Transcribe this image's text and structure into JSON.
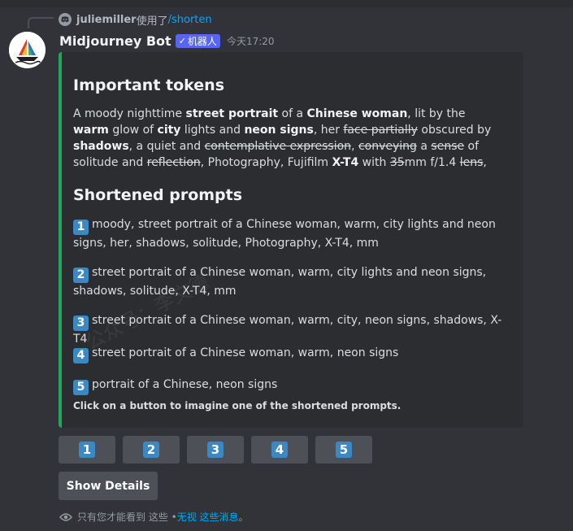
{
  "reply": {
    "user": "juliemiller",
    "used": "使用了",
    "command": "/shorten"
  },
  "message": {
    "author": "Midjourney Bot",
    "bot_tag": "机器人",
    "bot_check": "✓",
    "timestamp": "今天17:20"
  },
  "embed": {
    "accent_color": "#23a55a",
    "title_tokens": "Important tokens",
    "title_shortened": "Shortened prompts",
    "tokens_text": [
      {
        "t": "A moody nighttime ",
        "s": "normal"
      },
      {
        "t": "street portrait",
        "s": "bold"
      },
      {
        "t": " of a ",
        "s": "normal"
      },
      {
        "t": "Chinese woman",
        "s": "bold"
      },
      {
        "t": ", lit by the ",
        "s": "normal"
      },
      {
        "t": "warm",
        "s": "bold"
      },
      {
        "t": " glow of ",
        "s": "normal"
      },
      {
        "t": "city",
        "s": "bold"
      },
      {
        "t": " lights and ",
        "s": "normal"
      },
      {
        "t": "neon signs",
        "s": "bold"
      },
      {
        "t": ", her ",
        "s": "normal"
      },
      {
        "t": "face partially",
        "s": "strike"
      },
      {
        "t": " obscured by ",
        "s": "normal"
      },
      {
        "t": "shadows",
        "s": "bold"
      },
      {
        "t": ", a quiet and ",
        "s": "normal"
      },
      {
        "t": "contemplative expression",
        "s": "strike"
      },
      {
        "t": ", ",
        "s": "normal"
      },
      {
        "t": "conveying",
        "s": "strike"
      },
      {
        "t": " a ",
        "s": "normal"
      },
      {
        "t": "sense",
        "s": "strike"
      },
      {
        "t": " of solitude and ",
        "s": "normal"
      },
      {
        "t": "reflection",
        "s": "strike"
      },
      {
        "t": ", Photography, Fujifilm ",
        "s": "normal"
      },
      {
        "t": "X-T4",
        "s": "bold"
      },
      {
        "t": " with ",
        "s": "normal"
      },
      {
        "t": "35",
        "s": "strike"
      },
      {
        "t": "mm f/1.4 ",
        "s": "normal"
      },
      {
        "t": "lens",
        "s": "strike"
      },
      {
        "t": ",",
        "s": "normal"
      }
    ],
    "prompts": [
      {
        "num": "1",
        "text": "moody, street portrait of a Chinese woman, warm, city lights and neon signs, her, shadows, solitude, Photography, X-T4, mm"
      },
      {
        "num": "2",
        "text": "street portrait of a Chinese woman, warm, city lights and neon signs, shadows, solitude, X-T4, mm"
      },
      {
        "num": "3",
        "text": "street portrait of a Chinese woman, warm, city, neon signs, shadows, X-T4"
      },
      {
        "num": "4",
        "text": "street portrait of a Chinese woman, warm, neon signs"
      },
      {
        "num": "5",
        "text": "portrait of a Chinese, neon signs"
      }
    ],
    "footer": "Click on a button to imagine one of the shortened prompts.",
    "watermark": "公众号：李文德"
  },
  "buttons": [
    "1",
    "2",
    "3",
    "4",
    "5"
  ],
  "details_button": "Show Details",
  "ephemeral": {
    "prefix": "只有您才能看到 这些 • ",
    "dismiss": "无视 这些消息",
    "suffix": "。"
  }
}
